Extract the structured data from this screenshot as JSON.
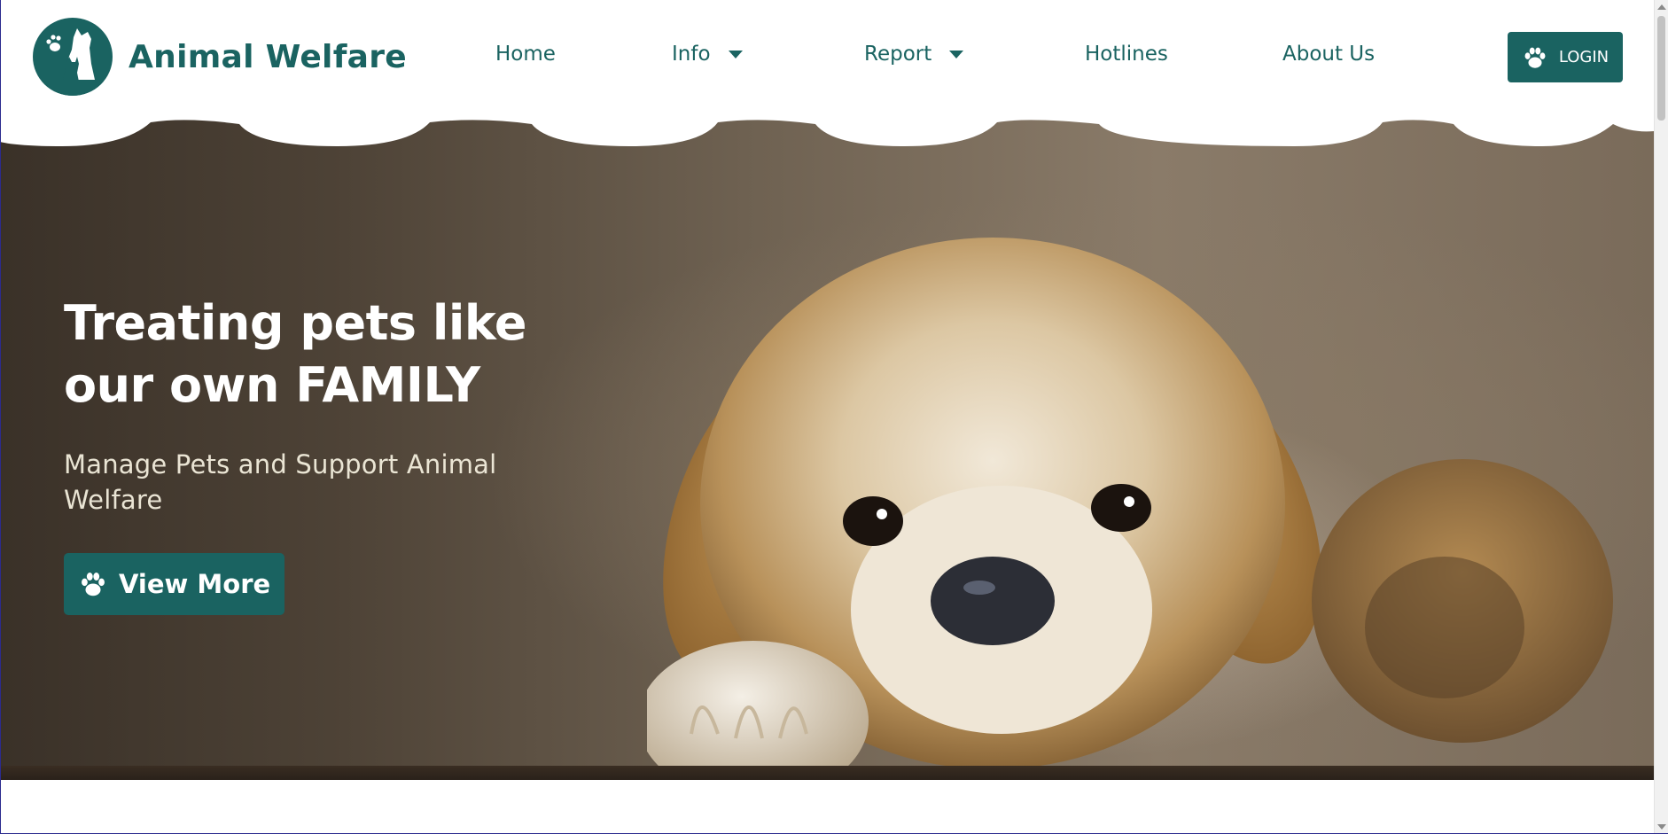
{
  "brand": {
    "name": "Animal Welfare",
    "logo_icon": "dog-cat-paw-logo"
  },
  "nav": {
    "items": [
      {
        "label": "Home",
        "dropdown": false
      },
      {
        "label": "Info",
        "dropdown": true
      },
      {
        "label": "Report",
        "dropdown": true
      },
      {
        "label": "Hotlines",
        "dropdown": false
      },
      {
        "label": "About Us",
        "dropdown": false
      }
    ],
    "login_label": "LOGIN",
    "login_icon": "paw-icon"
  },
  "hero": {
    "title_line1": "Treating pets like",
    "title_line2": "our own FAMILY",
    "subtitle": "Manage Pets and Support Animal Welfare",
    "cta_label": "View More",
    "cta_icon": "paw-icon",
    "image": "puppy-photo"
  },
  "colors": {
    "accent": "#1a6361",
    "header_bg": "#ffffff",
    "hero_text": "#ffffff"
  }
}
